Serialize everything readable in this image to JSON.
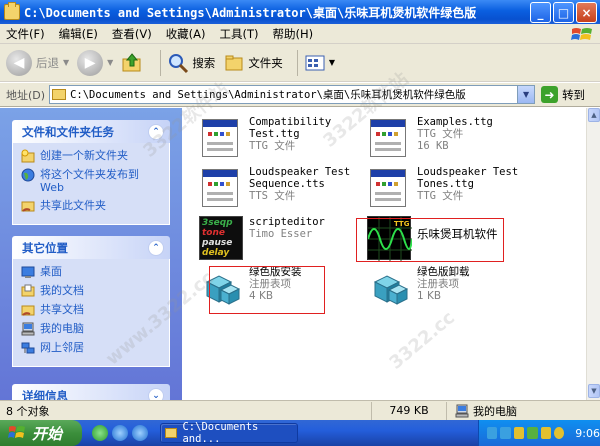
{
  "window": {
    "title": "C:\\Documents and Settings\\Administrator\\桌面\\乐味耳机煲机软件绿色版",
    "controls": [
      "_",
      "□",
      "×"
    ]
  },
  "menu": [
    "文件(F)",
    "编辑(E)",
    "查看(V)",
    "收藏(A)",
    "工具(T)",
    "帮助(H)"
  ],
  "toolbar": {
    "back": "后退",
    "forward": "",
    "search": "搜索",
    "folders": "文件夹"
  },
  "address": {
    "label": "地址(D)",
    "value": "C:\\Documents and Settings\\Administrator\\桌面\\乐味耳机煲机软件绿色版",
    "go": "转到"
  },
  "tasks": {
    "file_tasks": {
      "title": "文件和文件夹任务",
      "items": [
        "创建一个新文件夹",
        "将这个文件夹发布到 Web",
        "共享此文件夹"
      ]
    },
    "other_places": {
      "title": "其它位置",
      "items": [
        "桌面",
        "我的文档",
        "共享文档",
        "我的电脑",
        "网上邻居"
      ]
    },
    "details": {
      "title": "详细信息"
    }
  },
  "files": [
    {
      "name1": "Compatibility",
      "name2": "Test.ttg",
      "type": "TTG 文件",
      "size": ""
    },
    {
      "name1": "Examples.ttg",
      "name2": "",
      "type": "TTG 文件",
      "size": "16 KB"
    },
    {
      "name1": "Loudspeaker Test",
      "name2": "Sequence.tts",
      "type": "TTS 文件",
      "size": ""
    },
    {
      "name1": "Loudspeaker Test",
      "name2": "Tones.ttg",
      "type": "TTG 文件",
      "size": ""
    },
    {
      "name1": "scripteditor",
      "name2": "",
      "type": "Timo Esser",
      "size": ""
    },
    {
      "name1": "乐味煲耳机软件",
      "name2": "",
      "type": "",
      "size": ""
    },
    {
      "name1": "绿色版安装",
      "name2": "",
      "type": "注册表项",
      "size": "4 KB"
    },
    {
      "name1": "绿色版卸载",
      "name2": "",
      "type": "注册表项",
      "size": "1 KB"
    }
  ],
  "icon_text": {
    "script_lines": [
      "3seqp",
      "tone",
      "pause",
      "delay"
    ],
    "ttg_badge": "TTG"
  },
  "status": {
    "count": "8 个对象",
    "size": "749 KB",
    "location": "我的电脑"
  },
  "taskbar": {
    "start": "开始",
    "window_button": "C:\\Documents and...",
    "clock": "9:06"
  },
  "watermarks": [
    "3322软件站",
    "3322软件站",
    "www.3322.cc",
    "3322.cc"
  ]
}
